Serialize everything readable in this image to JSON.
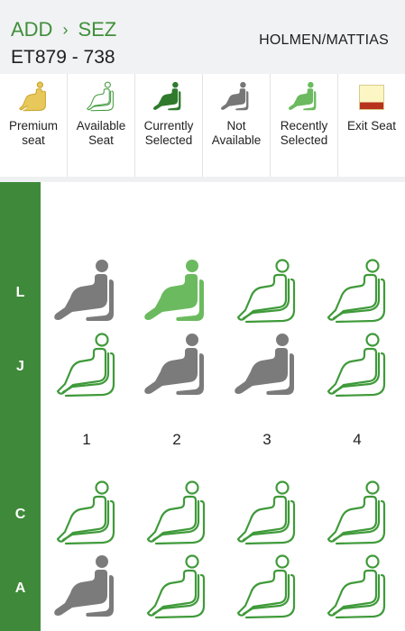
{
  "header": {
    "origin": "ADD",
    "separator": "›",
    "destination": "SEZ",
    "flight": "ET879 - 738",
    "passenger": "HOLMEN/MATTIAS"
  },
  "legend": [
    {
      "key": "premium",
      "label": "Premium seat",
      "line1": "Premium",
      "line2": "seat",
      "icon": "premium-seat-icon",
      "color": "#d4b13c"
    },
    {
      "key": "available",
      "label": "Available Seat",
      "line1": "Available",
      "line2": "Seat",
      "icon": "available-seat-icon",
      "color": "#3f9a3a"
    },
    {
      "key": "selected",
      "label": "Currently Selected",
      "line1": "Currently",
      "line2": "Selected",
      "icon": "selected-seat-icon",
      "color": "#2f7a2d"
    },
    {
      "key": "unavailable",
      "label": "Not Available",
      "line1": "Not",
      "line2": "Available",
      "icon": "unavailable-seat-icon",
      "color": "#777777"
    },
    {
      "key": "recent",
      "label": "Recently Selected",
      "line1": "Recently",
      "line2": "Selected",
      "icon": "recent-seat-icon",
      "color": "#6cba5f"
    },
    {
      "key": "exit",
      "label": "Exit Seat",
      "line1": "Exit Seat",
      "line2": "",
      "icon": "exit-seat-swatch",
      "color": "#fbf6c4"
    }
  ],
  "colors": {
    "brand_green": "#3f8a3a",
    "available_outline": "#3f9a3a",
    "unavailable": "#7b7b7b",
    "recent": "#6cba5f"
  },
  "rows": [
    "L",
    "J",
    "C",
    "A"
  ],
  "columns": [
    "1",
    "2",
    "3",
    "4"
  ],
  "seats": {
    "L": [
      "unavailable",
      "recent",
      "available",
      "available"
    ],
    "J": [
      "available",
      "unavailable",
      "unavailable",
      "available"
    ],
    "C": [
      "available",
      "available",
      "available",
      "available"
    ],
    "A": [
      "unavailable",
      "available",
      "available",
      "available"
    ]
  }
}
